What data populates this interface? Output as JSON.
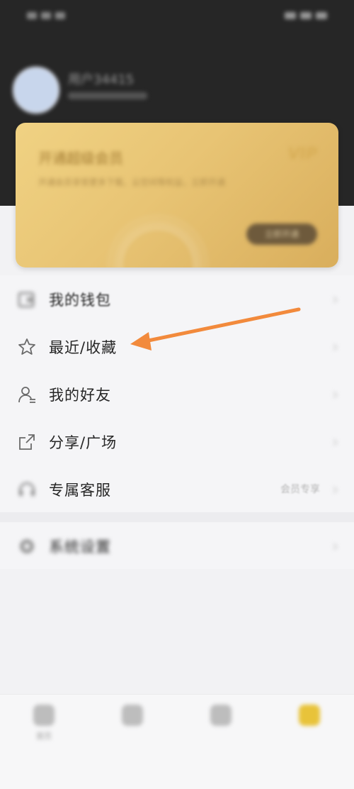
{
  "status_bar": {
    "left": "●●● ⇆ ◌",
    "right": "●●● 5:35"
  },
  "profile": {
    "name": "用户34415",
    "subtitle": ""
  },
  "vip": {
    "title": "开通超级会员",
    "badge": "VIP",
    "description": "开通会员享受更多下载、云空间等权益，立即开通",
    "button": "立即开通"
  },
  "menu": {
    "items": [
      {
        "label": "我的钱包",
        "icon": "wallet-icon",
        "extra": ""
      },
      {
        "label": "最近/收藏",
        "icon": "star-icon",
        "extra": ""
      },
      {
        "label": "我的好友",
        "icon": "friends-icon",
        "extra": ""
      },
      {
        "label": "分享/广场",
        "icon": "share-icon",
        "extra": ""
      },
      {
        "label": "专属客服",
        "icon": "headset-icon",
        "extra": "会员专享"
      }
    ],
    "chevron": "›"
  },
  "settings": {
    "label": "系统设置",
    "icon": "gear-icon"
  },
  "tabbar": {
    "tabs": [
      {
        "label": "首页",
        "icon": "home-icon"
      },
      {
        "label": "",
        "icon": "chat-icon"
      },
      {
        "label": "",
        "icon": "discover-icon"
      },
      {
        "label": "",
        "icon": "profile-icon"
      }
    ],
    "active_index": 3
  },
  "colors": {
    "header_bg": "#262626",
    "vip_gold": "#e8c474",
    "arrow": "#f28a3c",
    "tab_active": "#e8c33a"
  }
}
